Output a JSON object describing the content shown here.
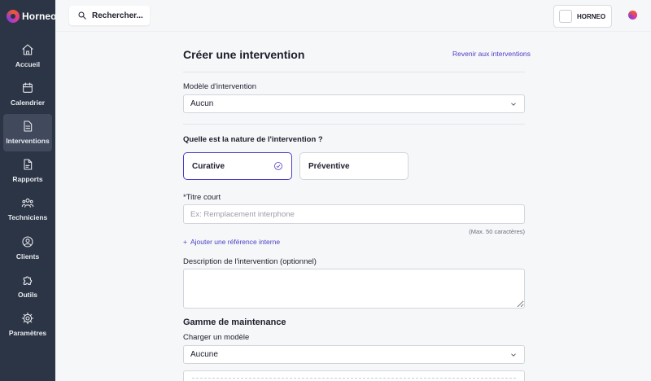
{
  "brand": {
    "name": "Horneo"
  },
  "sidebar": {
    "items": [
      {
        "label": "Accueil",
        "icon": "home-icon"
      },
      {
        "label": "Calendrier",
        "icon": "calendar-icon"
      },
      {
        "label": "Interventions",
        "icon": "document-icon",
        "active": true
      },
      {
        "label": "Rapports",
        "icon": "report-icon"
      },
      {
        "label": "Techniciens",
        "icon": "users-icon"
      },
      {
        "label": "Clients",
        "icon": "user-circle-icon"
      },
      {
        "label": "Outils",
        "icon": "puzzle-icon"
      },
      {
        "label": "Paramètres",
        "icon": "gear-icon"
      }
    ]
  },
  "header": {
    "search_label": "Rechercher...",
    "company_name": "HORNEO"
  },
  "form": {
    "title": "Créer une intervention",
    "back_link": "Revenir aux interventions",
    "model_label": "Modèle d'intervention",
    "model_value": "Aucun",
    "nature_label": "Quelle est la nature de l'intervention ?",
    "nature_options": [
      {
        "label": "Curative",
        "selected": true
      },
      {
        "label": "Préventive",
        "selected": false
      }
    ],
    "title_label": "*Titre court",
    "title_placeholder": "Ex: Remplacement interphone",
    "title_hint": "(Max. 50 caractères)",
    "add_reference": "Ajouter une référence interne",
    "description_label": "Description de l'intervention (optionnel)",
    "maintenance_title": "Gamme de maintenance",
    "load_model_label": "Charger un modèle",
    "load_model_value": "Aucune"
  },
  "colors": {
    "sidebar_bg": "#2c3545",
    "accent": "#4b3fc7",
    "page_bg": "#f6f7f9"
  }
}
